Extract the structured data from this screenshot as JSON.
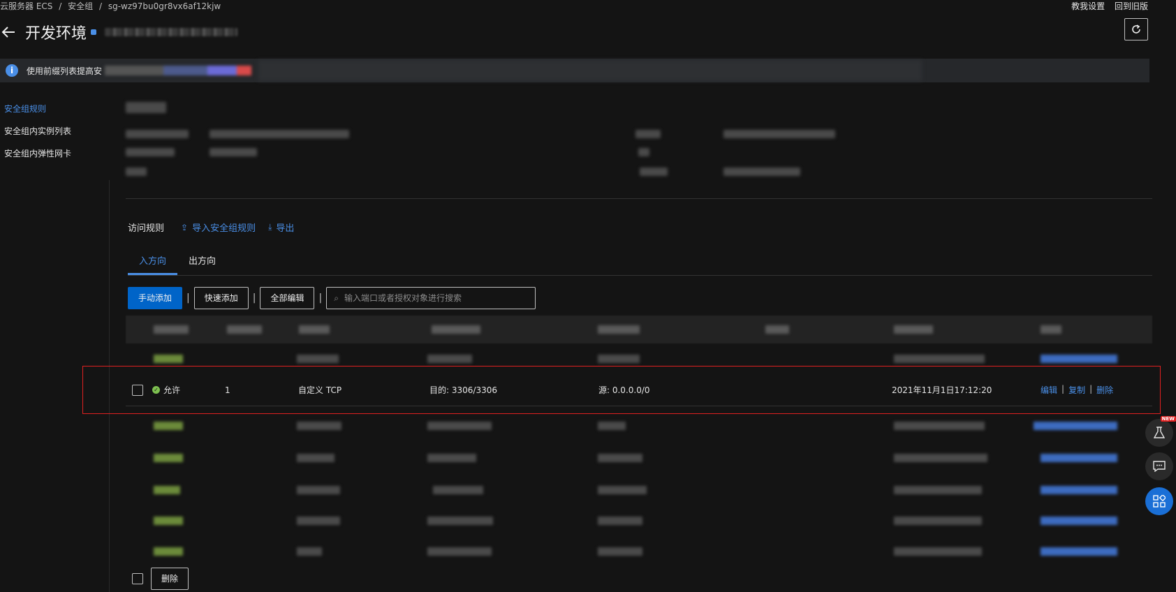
{
  "breadcrumb": [
    "云服务器 ECS",
    "/",
    "安全组",
    "/",
    "sg-wz97bu0gr8vx6af12kjw"
  ],
  "top_links": [
    "教我设置",
    "回到旧版"
  ],
  "page_title": "开发环境",
  "info_text": "使用前缀列表提高安",
  "sidenav": [
    {
      "label": "安全组规则",
      "active": true
    },
    {
      "label": "安全组内实例列表",
      "active": false
    },
    {
      "label": "安全组内弹性网卡",
      "active": false
    }
  ],
  "access": {
    "label": "访问规则",
    "import_label": "导入安全组规则",
    "export_label": "导出"
  },
  "tabs": [
    {
      "label": "入方向",
      "active": true
    },
    {
      "label": "出方向",
      "active": false
    }
  ],
  "toolbar": {
    "manual_add": "手动添加",
    "quick_add": "快速添加",
    "edit_all": "全部编辑",
    "separator": "|",
    "search_placeholder": "输入端口或者授权对象进行搜索"
  },
  "highlight_row": {
    "policy": "允许",
    "priority": "1",
    "protocol": "自定义 TCP",
    "port_range": "目的: 3306/3306",
    "source": "源: 0.0.0.0/0",
    "created": "2021年11月1日17:12:20",
    "edit": "编辑",
    "copy": "复制",
    "delete": "删除",
    "sep": "|"
  },
  "bottom": {
    "delete_label": "删除"
  },
  "floating": {
    "new_badge": "NEW"
  },
  "colors": {
    "accent": "#4a8fe7",
    "primary_button": "#0064c8",
    "highlight_border": "#e02020",
    "allow_green": "#7ec050"
  }
}
